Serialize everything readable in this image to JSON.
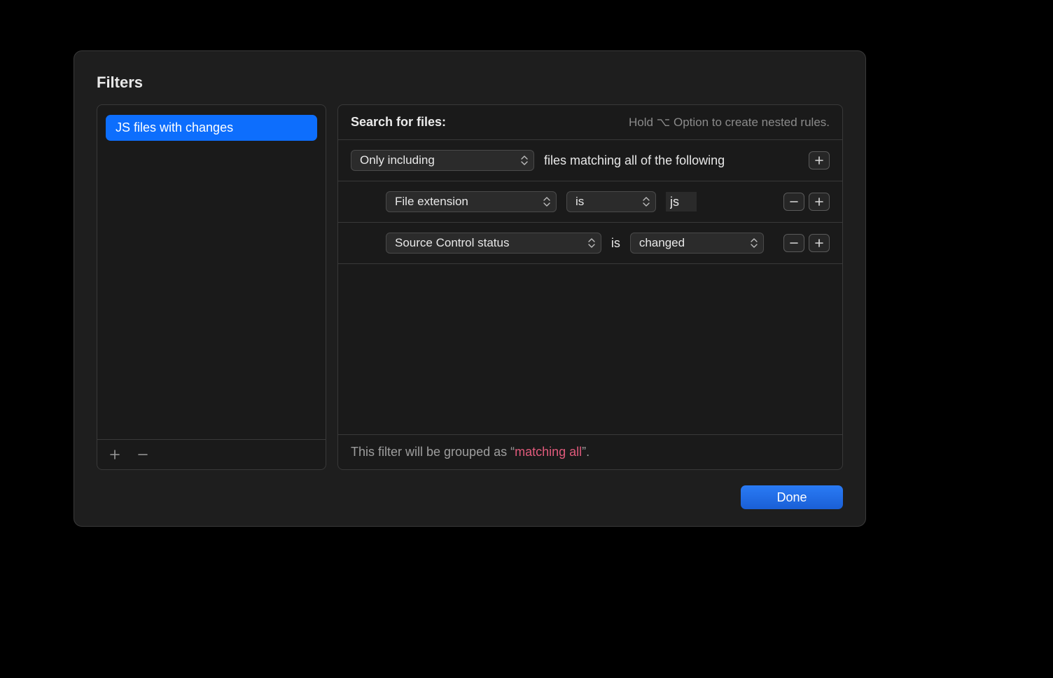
{
  "title": "Filters",
  "sidebar": {
    "items": [
      {
        "label": "JS files with changes",
        "selected": true
      }
    ]
  },
  "header": {
    "label": "Search for files:",
    "hint_prefix": "Hold ",
    "hint_key": "⌥",
    "hint_suffix": " Option to create nested rules."
  },
  "root_rule": {
    "scope": "Only including",
    "suffix": "files matching all of the following"
  },
  "rules": [
    {
      "attribute": "File extension",
      "operator": "is",
      "value": "js",
      "value_type": "text"
    },
    {
      "attribute": "Source Control status",
      "operator": "is",
      "value": "changed",
      "value_type": "popup"
    }
  ],
  "summary": {
    "prefix": "This filter will be grouped as “",
    "highlight": "matching all",
    "suffix": "”."
  },
  "buttons": {
    "done": "Done"
  }
}
